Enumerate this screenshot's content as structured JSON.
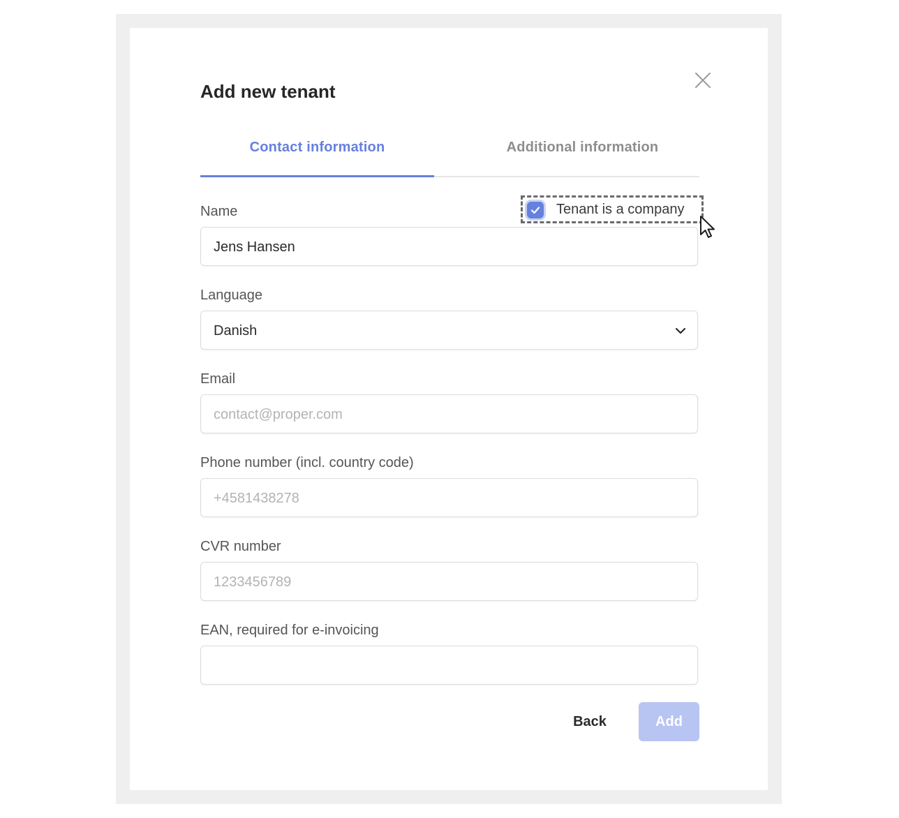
{
  "dialog": {
    "title": "Add new tenant",
    "close_icon": "close-icon"
  },
  "tabs": [
    {
      "label": "Contact information",
      "active": true
    },
    {
      "label": "Additional information",
      "active": false
    }
  ],
  "form": {
    "name": {
      "label": "Name",
      "value": "Jens Hansen"
    },
    "company_toggle": {
      "label": "Tenant is a company",
      "checked": true
    },
    "language": {
      "label": "Language",
      "value": "Danish"
    },
    "email": {
      "label": "Email",
      "placeholder": "contact@proper.com"
    },
    "phone": {
      "label": "Phone number (incl. country code)",
      "placeholder": "+4581438278"
    },
    "cvr": {
      "label": "CVR number",
      "placeholder": "1233456789"
    },
    "ean": {
      "label": "EAN, required for e-invoicing",
      "placeholder": ""
    }
  },
  "actions": {
    "back_label": "Back",
    "add_label": "Add"
  },
  "colors": {
    "accent": "#6680dd",
    "accent_disabled": "#b8c4f2",
    "frame": "#efefef"
  }
}
